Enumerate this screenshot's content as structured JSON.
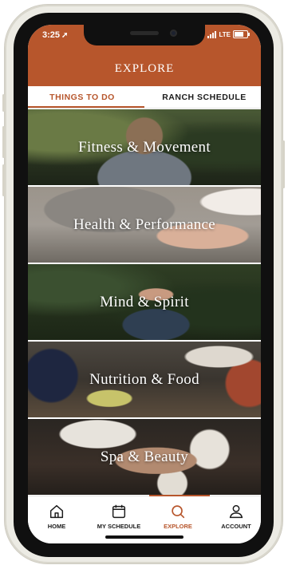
{
  "status_bar": {
    "time": "3:25",
    "location_glyph": "➚",
    "network": "LTE"
  },
  "header": {
    "title": "EXPLORE"
  },
  "tabs": [
    {
      "label": "THINGS TO DO",
      "active": true
    },
    {
      "label": "RANCH SCHEDULE",
      "active": false
    }
  ],
  "categories": [
    {
      "title": "Fitness & Movement"
    },
    {
      "title": "Health & Performance"
    },
    {
      "title": "Mind & Spirit"
    },
    {
      "title": "Nutrition & Food"
    },
    {
      "title": "Spa & Beauty"
    }
  ],
  "bottom_nav": [
    {
      "label": "HOME",
      "icon": "home-icon"
    },
    {
      "label": "MY SCHEDULE",
      "icon": "calendar-icon"
    },
    {
      "label": "EXPLORE",
      "icon": "search-icon",
      "active": true
    },
    {
      "label": "ACCOUNT",
      "icon": "user-icon"
    }
  ],
  "colors": {
    "accent": "#b7562c",
    "nav_text": "#1b1b1b",
    "header_text": "#ffffff"
  }
}
